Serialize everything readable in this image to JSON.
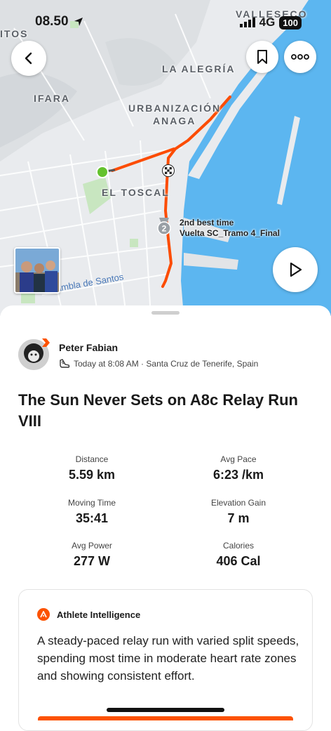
{
  "status_bar": {
    "time": "08.50",
    "network": "4G",
    "battery": "100"
  },
  "map": {
    "labels": {
      "vallesecc": "VALLESECO",
      "itos": "ITOS",
      "laalegria": "LA ALEGRÍA",
      "ifara": "IFARA",
      "urbanizacion": "URBANIZACIÓN",
      "anaga": "ANAGA",
      "eltoscal": "EL TOSCAL",
      "street": "Rambla de Santos"
    },
    "segment": {
      "rank": "2",
      "line1": "2nd best time",
      "line2": "Vuelta SC_Tramo 4_Final"
    }
  },
  "athlete": {
    "name": "Peter Fabian",
    "meta": "Today at 8:08 AM · Santa Cruz de Tenerife, Spain"
  },
  "activity": {
    "title": "The Sun Never Sets on A8c Relay Run VIII"
  },
  "stats": [
    {
      "label": "Distance",
      "value": "5.59 km"
    },
    {
      "label": "Avg Pace",
      "value": "6:23 /km"
    },
    {
      "label": "Moving Time",
      "value": "35:41"
    },
    {
      "label": "Elevation Gain",
      "value": "7 m"
    },
    {
      "label": "Avg Power",
      "value": "277 W"
    },
    {
      "label": "Calories",
      "value": "406 Cal"
    }
  ],
  "intelligence": {
    "heading": "Athlete Intelligence",
    "text": "A steady-paced relay run with varied split speeds, spending most time in moderate heart rate zones and showing consistent effort."
  },
  "colors": {
    "accent": "#fc5200",
    "sea": "#5cb6f0",
    "start": "#63c22d"
  },
  "icons": [
    "back-chevron-icon",
    "bookmark-icon",
    "more-icon",
    "play-icon",
    "location-arrow-icon",
    "signal-icon",
    "shoe-icon",
    "athlete-intelligence-icon",
    "finish-flag-icon",
    "medal-icon"
  ]
}
